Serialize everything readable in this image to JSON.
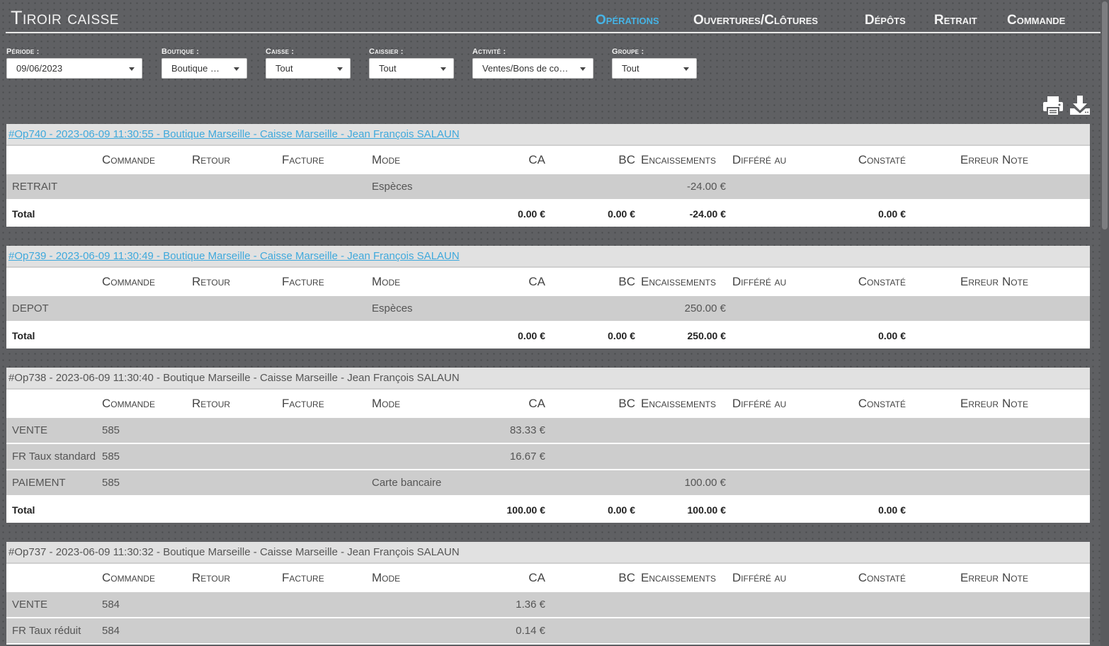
{
  "app": {
    "title": "Tiroir caisse"
  },
  "nav": [
    {
      "label": "Opérations",
      "active": true
    },
    {
      "label": "Ouvertures/Clôtures",
      "active": false
    },
    {
      "label": "Dépôts",
      "active": false
    },
    {
      "label": "Retrait",
      "active": false
    },
    {
      "label": "Commande",
      "active": false
    }
  ],
  "filters": [
    {
      "label": "Période :",
      "value": "09/06/2023"
    },
    {
      "label": "Boutique :",
      "value": "Boutique Marseille"
    },
    {
      "label": "Caisse :",
      "value": "Tout"
    },
    {
      "label": "Caissier :",
      "value": "Tout"
    },
    {
      "label": "Activité :",
      "value": "Ventes/Bons de commande"
    },
    {
      "label": "Groupe :",
      "value": "Tout"
    }
  ],
  "toolbar": {
    "print_icon": "printer-icon",
    "download_icon": "download-icon"
  },
  "columns": [
    "",
    "Commande",
    "Retour",
    "Facture",
    "Mode",
    "CA",
    "BC",
    "Encaissements",
    "Différé au",
    "Constaté",
    "Erreur",
    "Note"
  ],
  "operations": [
    {
      "title": "#Op740 - 2023-06-09 11:30:55 - Boutique Marseille - Caisse Marseille - Jean François SALAUN",
      "link": true,
      "rows": [
        [
          "RETRAIT",
          "",
          "",
          "",
          "Espèces",
          "",
          "",
          "-24.00 €",
          "",
          "",
          "",
          ""
        ]
      ],
      "total": [
        "Total",
        "",
        "",
        "",
        "",
        "0.00 €",
        "0.00 €",
        "-24.00 €",
        "",
        "0.00 €",
        "",
        ""
      ]
    },
    {
      "title": "#Op739 - 2023-06-09 11:30:49 - Boutique Marseille - Caisse Marseille - Jean François SALAUN",
      "link": true,
      "rows": [
        [
          "DEPOT",
          "",
          "",
          "",
          "Espèces",
          "",
          "",
          "250.00 €",
          "",
          "",
          "",
          ""
        ]
      ],
      "total": [
        "Total",
        "",
        "",
        "",
        "",
        "0.00 €",
        "0.00 €",
        "250.00 €",
        "",
        "0.00 €",
        "",
        ""
      ]
    },
    {
      "title": "#Op738 - 2023-06-09 11:30:40 - Boutique Marseille - Caisse Marseille - Jean François SALAUN",
      "link": false,
      "rows": [
        [
          "VENTE",
          "585",
          "",
          "",
          "",
          "83.33 €",
          "",
          "",
          "",
          "",
          "",
          ""
        ],
        [
          "FR Taux standard",
          "585",
          "",
          "",
          "",
          "16.67 €",
          "",
          "",
          "",
          "",
          "",
          ""
        ],
        [
          "PAIEMENT",
          "585",
          "",
          "",
          "Carte bancaire",
          "",
          "",
          "100.00 €",
          "",
          "",
          "",
          ""
        ]
      ],
      "total": [
        "Total",
        "",
        "",
        "",
        "",
        "100.00 €",
        "0.00 €",
        "100.00 €",
        "",
        "0.00 €",
        "",
        ""
      ]
    },
    {
      "title": "#Op737 - 2023-06-09 11:30:32 - Boutique Marseille - Caisse Marseille - Jean François SALAUN",
      "link": false,
      "rows": [
        [
          "VENTE",
          "584",
          "",
          "",
          "",
          "1.36 €",
          "",
          "",
          "",
          "",
          "",
          ""
        ],
        [
          "FR Taux réduit",
          "584",
          "",
          "",
          "",
          "0.14 €",
          "",
          "",
          "",
          "",
          "",
          ""
        ]
      ],
      "total": null
    }
  ]
}
